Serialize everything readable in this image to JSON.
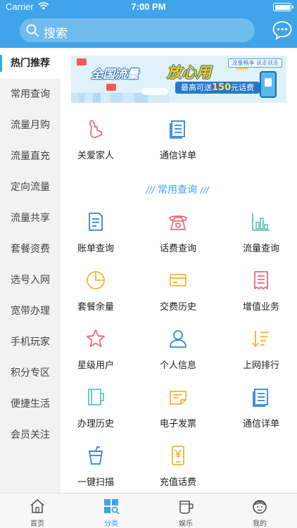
{
  "status_bar": {
    "carrier": "Carrier",
    "time": "7:00 PM"
  },
  "search": {
    "placeholder": "搜索"
  },
  "sidebar": {
    "items": [
      {
        "label": "热门推荐",
        "active": true
      },
      {
        "label": "常用查询"
      },
      {
        "label": "流量月购"
      },
      {
        "label": "流量直充"
      },
      {
        "label": "定向流量"
      },
      {
        "label": "流量共享"
      },
      {
        "label": "套餐资费"
      },
      {
        "label": "选号入网"
      },
      {
        "label": "宽带办理"
      },
      {
        "label": "手机玩家"
      },
      {
        "label": "积分专区"
      },
      {
        "label": "便捷生活"
      },
      {
        "label": "会员关注"
      }
    ]
  },
  "banner": {
    "title_part1": "全国流量",
    "title_part2": "放心用",
    "promo_prefix": "最高可送",
    "promo_amount": "150",
    "promo_suffix": "元话费",
    "tag": "流量畅享 说走就走"
  },
  "top_items": [
    {
      "label": "关爱家人",
      "icon": "hand-heart-icon"
    },
    {
      "label": "通信详单",
      "icon": "document-list-icon"
    }
  ],
  "section": {
    "mark_left": "///",
    "title": "常用查询",
    "mark_right": "///"
  },
  "query_items": [
    {
      "label": "账单查询",
      "icon": "bill-icon"
    },
    {
      "label": "话费查询",
      "icon": "telephone-icon"
    },
    {
      "label": "流量查询",
      "icon": "bar-chart-icon"
    },
    {
      "label": "套餐余量",
      "icon": "pie-chart-icon"
    },
    {
      "label": "交费历史",
      "icon": "card-icon"
    },
    {
      "label": "增值业务",
      "icon": "receipt-icon"
    },
    {
      "label": "星级用户",
      "icon": "star-icon"
    },
    {
      "label": "个人信息",
      "icon": "person-icon"
    },
    {
      "label": "上网排行",
      "icon": "ranking-icon"
    },
    {
      "label": "办理历史",
      "icon": "book-icon"
    },
    {
      "label": "电子发票",
      "icon": "invoice-icon"
    },
    {
      "label": "通信详单",
      "icon": "document-list-icon"
    },
    {
      "label": "一键扫描",
      "icon": "cup-icon"
    },
    {
      "label": "充值话费",
      "icon": "yuan-phone-icon"
    }
  ],
  "tabbar": {
    "tabs": [
      {
        "label": "首页",
        "icon": "home-icon"
      },
      {
        "label": "分类",
        "icon": "category-icon",
        "active": true
      },
      {
        "label": "娱乐",
        "icon": "mug-icon"
      },
      {
        "label": "我的",
        "icon": "face-icon"
      }
    ]
  },
  "colors": {
    "brand": "#3fa4e9",
    "sidebar_bg": "#f2f2f2",
    "red": "#f06a78",
    "orange": "#f5b52e",
    "blue": "#2f87d6",
    "teal": "#5fc3c0"
  }
}
